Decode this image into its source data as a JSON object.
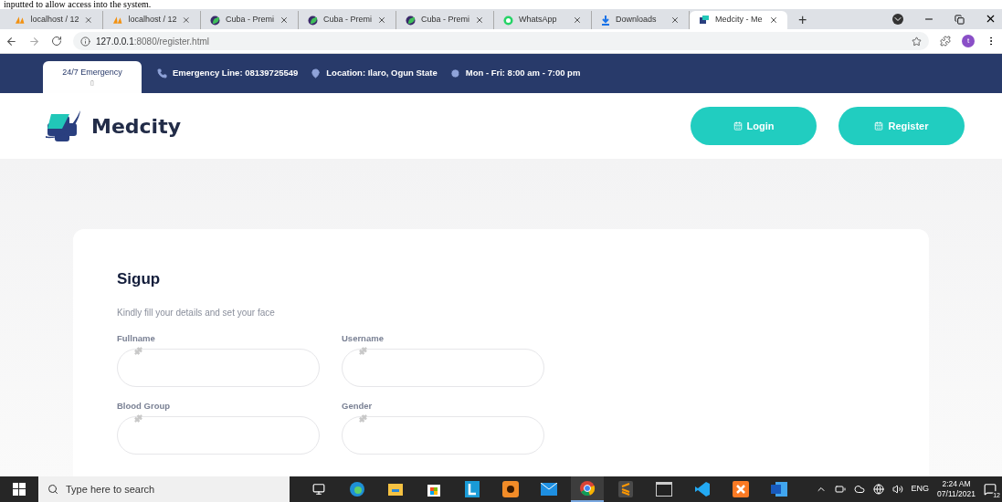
{
  "document_text": "inputted to allow access into the system.",
  "browser": {
    "tabs": [
      {
        "title": "localhost / 12",
        "kind": "pma",
        "selected": false
      },
      {
        "title": "localhost / 12",
        "kind": "pma",
        "selected": false
      },
      {
        "title": "Cuba - Premi",
        "kind": "cuba",
        "selected": false
      },
      {
        "title": "Cuba - Premi",
        "kind": "cuba",
        "selected": false
      },
      {
        "title": "Cuba - Premi",
        "kind": "cuba",
        "selected": false
      },
      {
        "title": "WhatsApp",
        "kind": "whatsapp",
        "selected": false
      },
      {
        "title": "Downloads",
        "kind": "download",
        "selected": false
      },
      {
        "title": "Medcity - Me",
        "kind": "medcity",
        "selected": true
      }
    ],
    "new_tab": "+",
    "url_host": "127.0.0.1",
    "url_path": ":8080/register.html",
    "profile": "t"
  },
  "topbar": {
    "tab": "24/7 Emergency",
    "tab_mark": "▯",
    "items": [
      {
        "kind": "phone",
        "text": "Emergency Line: 08139725549"
      },
      {
        "kind": "pin",
        "text": "Location: Ilaro, Ogun State"
      },
      {
        "kind": "clock",
        "text": "Mon - Fri: 8:00 am - 7:00 pm"
      }
    ]
  },
  "header": {
    "logo": "Medcity",
    "buttons": [
      "Login",
      "Register"
    ]
  },
  "form": {
    "title": "Sigup",
    "subtitle": "Kindly fill your details and set your face",
    "fields": [
      {
        "label": "Fullname"
      },
      {
        "label": "Username"
      },
      {
        "label": "Blood Group"
      },
      {
        "label": "Gender"
      }
    ]
  },
  "taskbar": {
    "search_placeholder": "Type here to search",
    "apps": [
      {
        "kind": "taskview",
        "selected": false
      },
      {
        "kind": "edge",
        "selected": false
      },
      {
        "kind": "folder",
        "selected": false
      },
      {
        "kind": "store",
        "selected": false
      },
      {
        "kind": "l",
        "selected": false
      },
      {
        "kind": "hand",
        "selected": false
      },
      {
        "kind": "mail",
        "selected": false
      },
      {
        "kind": "chrome",
        "selected": true
      },
      {
        "kind": "sublime",
        "selected": false
      },
      {
        "kind": "terminal",
        "selected": false
      },
      {
        "kind": "vscode",
        "selected": false
      },
      {
        "kind": "xampp",
        "selected": false
      },
      {
        "kind": "word",
        "selected": false
      }
    ],
    "lang": "ENG",
    "time": "2:24 AM",
    "date": "07/11/2021",
    "notifications": "12"
  }
}
